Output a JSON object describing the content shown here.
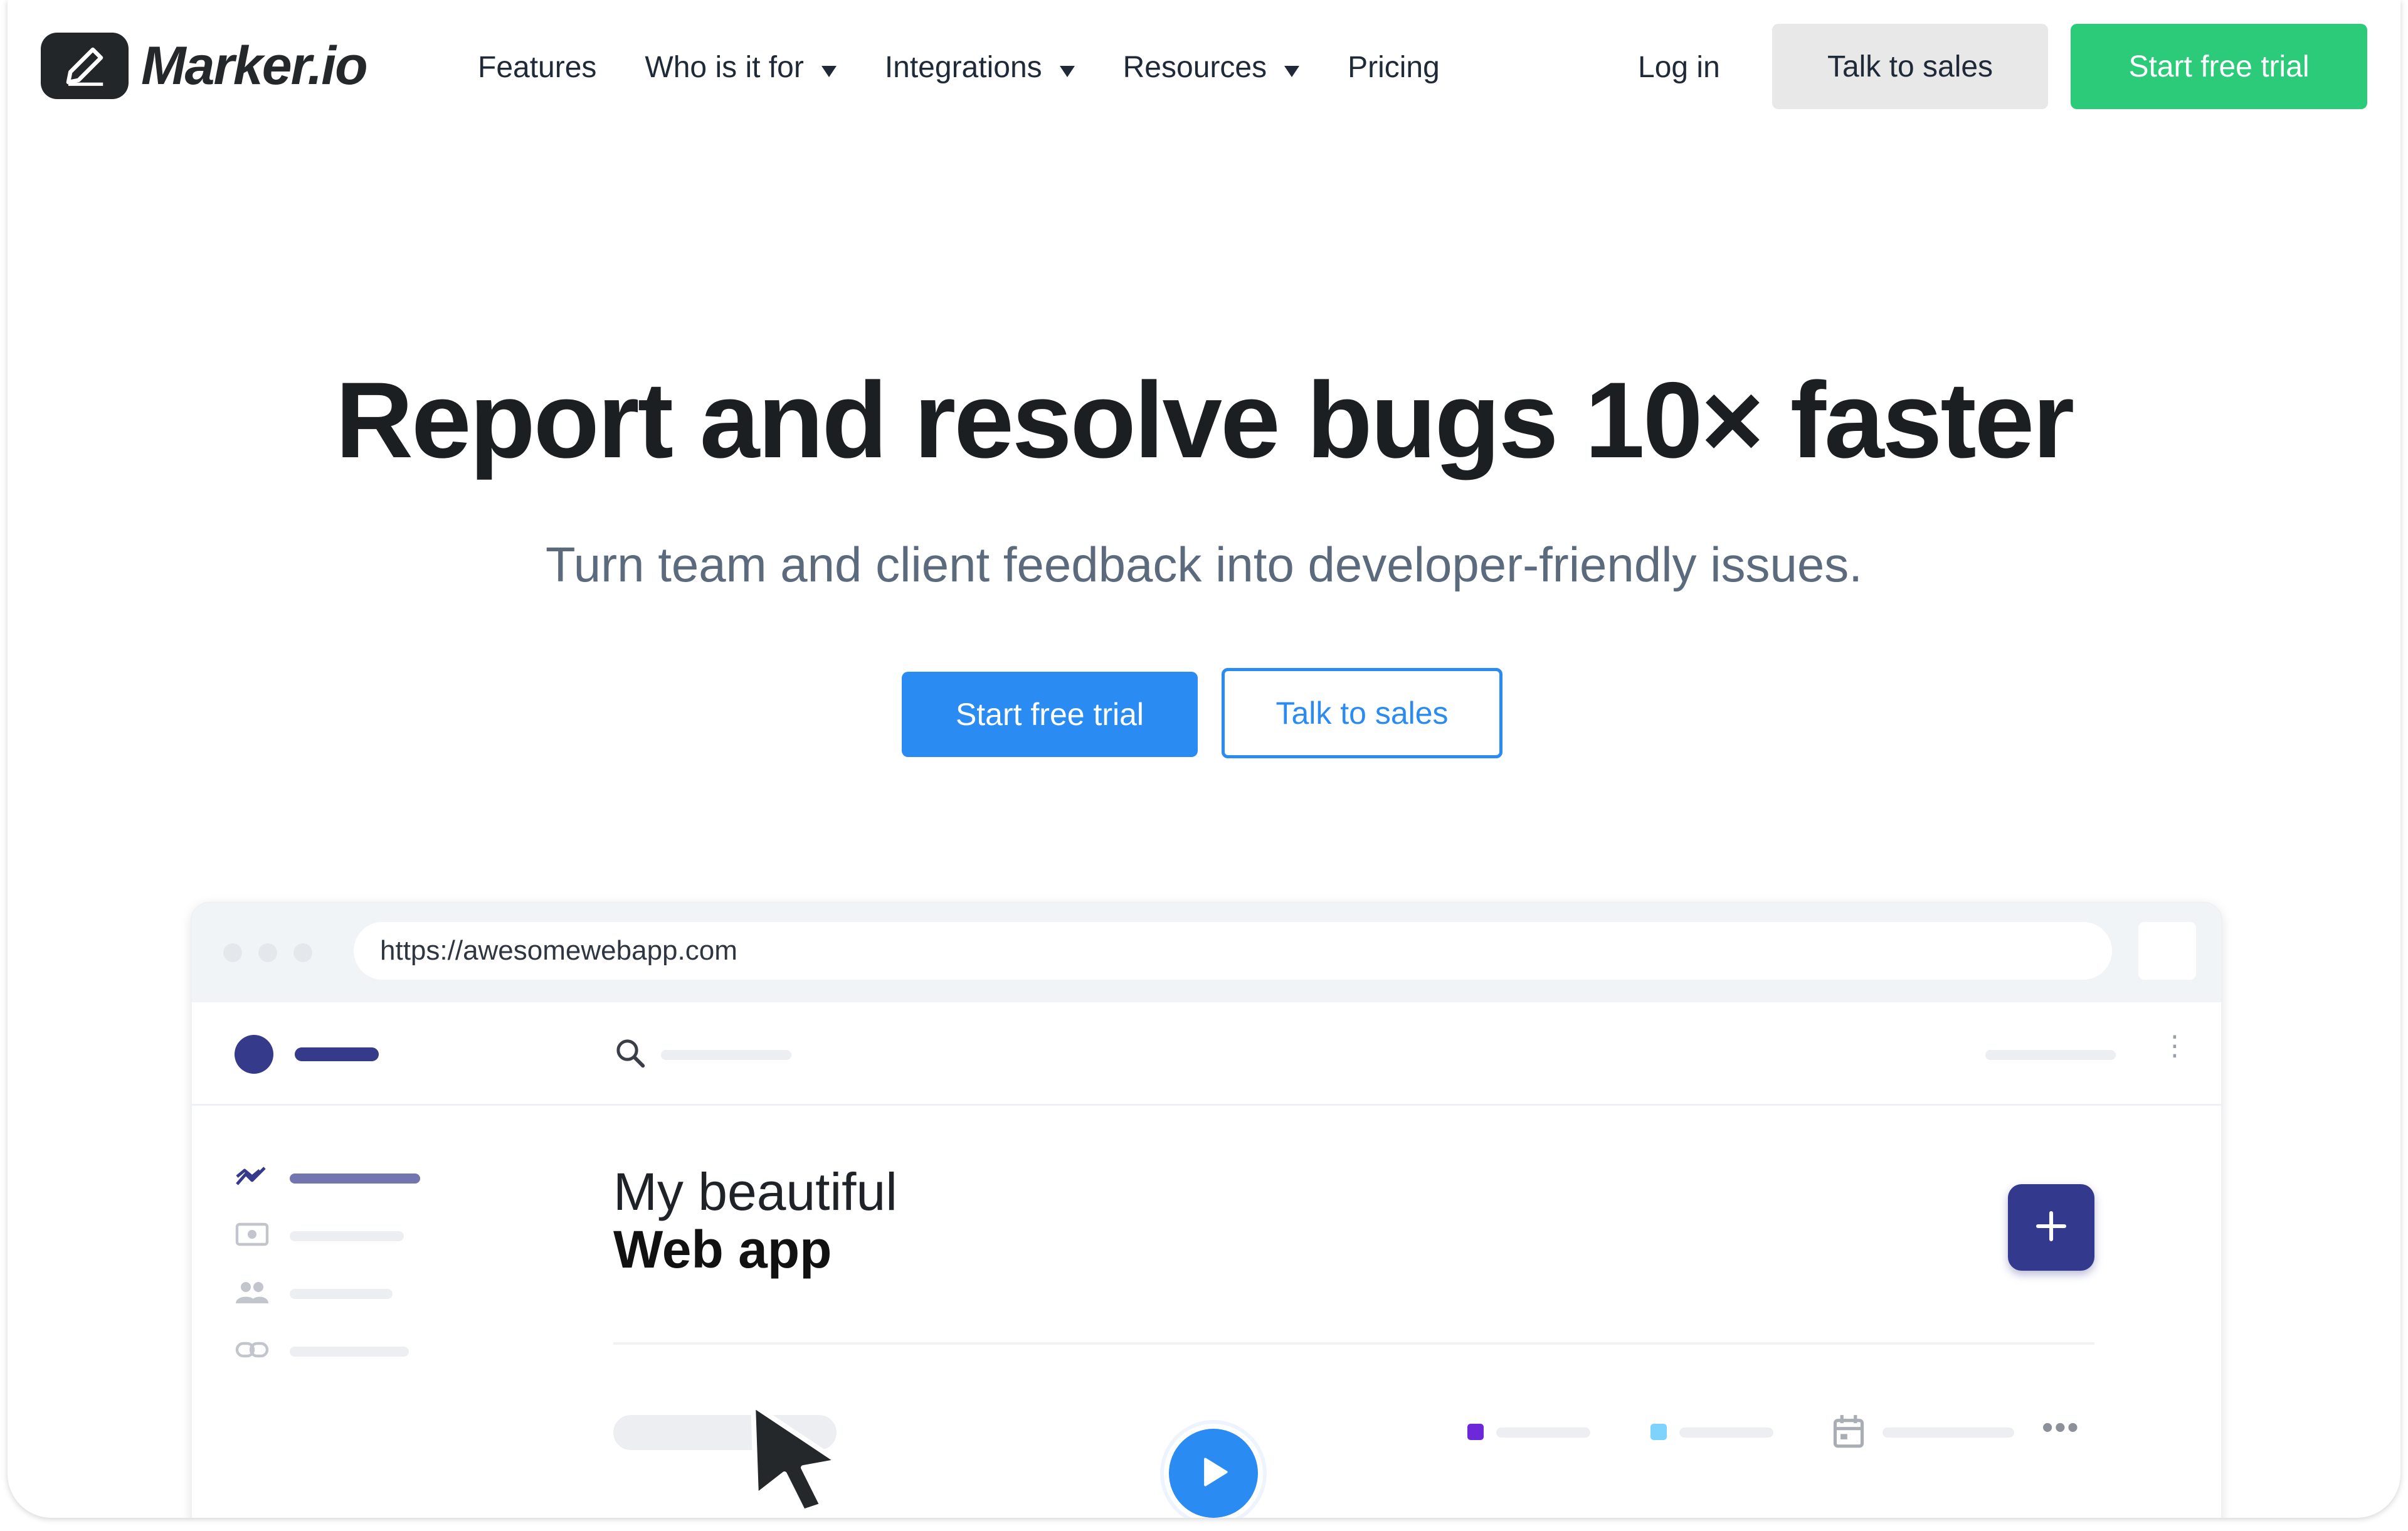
{
  "nav": {
    "logo_text": "Marker.io",
    "links": [
      {
        "label": "Features",
        "has_caret": false
      },
      {
        "label": "Who is it for",
        "has_caret": true
      },
      {
        "label": "Integrations",
        "has_caret": true
      },
      {
        "label": "Resources",
        "has_caret": true
      },
      {
        "label": "Pricing",
        "has_caret": false
      }
    ],
    "login_label": "Log in",
    "sales_label": "Talk to sales",
    "trial_label": "Start free trial"
  },
  "hero": {
    "title": "Report and resolve bugs 10× faster",
    "subtitle": "Turn team and client feedback into developer-friendly issues.",
    "primary_cta": "Start free trial",
    "secondary_cta": "Talk to sales"
  },
  "mockup": {
    "url": "https://awesomewebapp.com",
    "app_title_line1": "My beautiful",
    "app_title_line2": "Web app",
    "add_button_icon": "plus-icon",
    "sidebar_icons": [
      "trending-icon",
      "photo-icon",
      "people-icon",
      "link-icon"
    ],
    "legend_colors": [
      "#6d28d9",
      "#7dd3fc"
    ]
  },
  "colors": {
    "brand_green": "#2ccb7a",
    "brand_blue": "#2a8bf2",
    "app_accent": "#353a8b",
    "nav_sales_bg": "#e8e8e8"
  }
}
